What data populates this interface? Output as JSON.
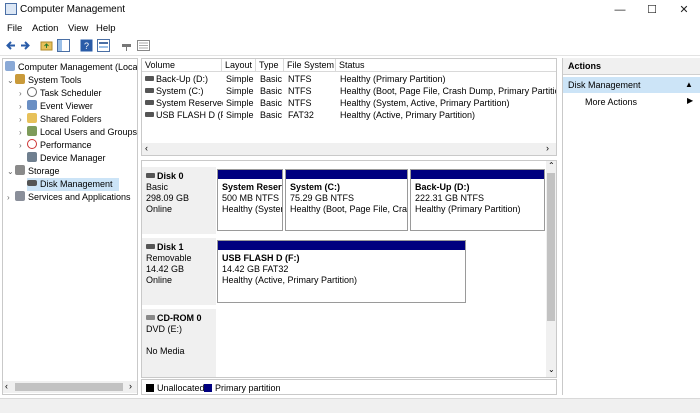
{
  "window": {
    "title": "Computer Management",
    "minimize": "—",
    "maximize": "☐",
    "close": "✕"
  },
  "menu": [
    "File",
    "Action",
    "View",
    "Help"
  ],
  "tree": {
    "root": "Computer Management (Local",
    "system_tools": "System Tools",
    "task_scheduler": "Task Scheduler",
    "event_viewer": "Event Viewer",
    "shared_folders": "Shared Folders",
    "local_users": "Local Users and Groups",
    "performance": "Performance",
    "device_manager": "Device Manager",
    "storage": "Storage",
    "disk_management": "Disk Management",
    "services": "Services and Applications"
  },
  "volume_table": {
    "headers": [
      "Volume",
      "Layout",
      "Type",
      "File System",
      "Status"
    ],
    "rows": [
      [
        "Back-Up (D:)",
        "Simple",
        "Basic",
        "NTFS",
        "Healthy (Primary Partition)"
      ],
      [
        "System (C:)",
        "Simple",
        "Basic",
        "NTFS",
        "Healthy (Boot, Page File, Crash Dump, Primary Partition)"
      ],
      [
        "System Reserved",
        "Simple",
        "Basic",
        "NTFS",
        "Healthy (System, Active, Primary Partition)"
      ],
      [
        "USB FLASH D (F:)",
        "Simple",
        "Basic",
        "FAT32",
        "Healthy (Active, Primary Partition)"
      ]
    ]
  },
  "disks": [
    {
      "name": "Disk 0",
      "type": "Basic",
      "size": "298.09 GB",
      "state": "Online",
      "partitions": [
        {
          "name": "System Reserv",
          "size": "500 MB NTFS",
          "status": "Healthy (Syster"
        },
        {
          "name": "System  (C:)",
          "size": "75.29 GB NTFS",
          "status": "Healthy (Boot, Page File, Cras"
        },
        {
          "name": "Back-Up  (D:)",
          "size": "222.31 GB NTFS",
          "status": "Healthy (Primary Partition)"
        }
      ]
    },
    {
      "name": "Disk 1",
      "type": "Removable",
      "size": "14.42 GB",
      "state": "Online",
      "partitions": [
        {
          "name": "USB FLASH D  (F:)",
          "size": "14.42 GB FAT32",
          "status": "Healthy (Active, Primary Partition)"
        }
      ]
    },
    {
      "name": "CD-ROM 0",
      "type": "DVD (E:)",
      "size": "",
      "state": "No Media",
      "partitions": []
    }
  ],
  "legend": {
    "unallocated": "Unallocated",
    "primary": "Primary partition",
    "unallocated_color": "#000000",
    "primary_color": "#00007f"
  },
  "actions": {
    "header": "Actions",
    "section": "Disk Management",
    "more": "More Actions"
  },
  "colors": {
    "selection": "#cce4f7",
    "partition_bar": "#00007f"
  }
}
